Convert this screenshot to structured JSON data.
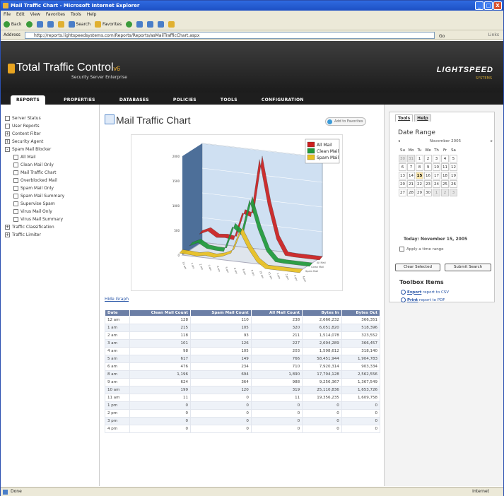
{
  "window": {
    "title": "Mail Traffic Chart - Microsoft Internet Explorer",
    "min": "_",
    "max": "□",
    "close": "X"
  },
  "menu": [
    "File",
    "Edit",
    "View",
    "Favorites",
    "Tools",
    "Help"
  ],
  "toolbar": {
    "back": "Back",
    "search": "Search",
    "favorites": "Favorites"
  },
  "address": {
    "label": "Address",
    "url": "http://reports.lightspeedsystems.com/Reports/Reports/asMailTrafficChart.aspx",
    "go": "Go",
    "links": "Links"
  },
  "brand": {
    "name": "Total Traffic Control",
    "version": "v6",
    "sub": "Security Server Enterprise",
    "vendor": "LIGHTSPEED",
    "vendor_sub": "SYSTEMS"
  },
  "nav": [
    "REPORTS",
    "PROPERTIES",
    "DATABASES",
    "POLICIES",
    "TOOLS",
    "CONFIGURATION"
  ],
  "sidebar": [
    {
      "label": "Server Status",
      "box": "",
      "child": false
    },
    {
      "label": "User Reports",
      "box": "",
      "child": false
    },
    {
      "label": "Content Filter",
      "box": "+",
      "child": false
    },
    {
      "label": "Security Agent",
      "box": "+",
      "child": false
    },
    {
      "label": "Spam Mail Blocker",
      "box": "-",
      "child": false
    },
    {
      "label": "All Mail",
      "box": "",
      "child": true
    },
    {
      "label": "Clean Mail Only",
      "box": "",
      "child": true
    },
    {
      "label": "Mail Traffic Chart",
      "box": "",
      "child": true
    },
    {
      "label": "Overblocked Mail",
      "box": "",
      "child": true
    },
    {
      "label": "Spam Mail Only",
      "box": "",
      "child": true
    },
    {
      "label": "Spam Mail Summary",
      "box": "",
      "child": true
    },
    {
      "label": "Supervise Spam",
      "box": "",
      "child": true
    },
    {
      "label": "Virus Mail Only",
      "box": "",
      "child": true
    },
    {
      "label": "Virus Mail Summary",
      "box": "",
      "child": true
    },
    {
      "label": "Traffic Classification",
      "box": "+",
      "child": false
    },
    {
      "label": "Traffic Limiter",
      "box": "+",
      "child": false
    }
  ],
  "main": {
    "title": "Mail Traffic Chart",
    "add_fav": "Add to Favorites",
    "hide_graph": "Hide Graph"
  },
  "legend": [
    {
      "name": "All Mail",
      "color": "#cc1f1f"
    },
    {
      "name": "Clean Mail",
      "color": "#1f9a3a"
    },
    {
      "name": "Spam Mail",
      "color": "#e8c020"
    }
  ],
  "chart_data": {
    "type": "line",
    "series": [
      {
        "name": "All Mail",
        "values": [
          238,
          320,
          211,
          227,
          203,
          766,
          710,
          1890,
          988,
          319,
          11,
          0,
          0,
          0,
          0
        ]
      },
      {
        "name": "Clean Mail",
        "values": [
          128,
          215,
          118,
          101,
          98,
          617,
          476,
          1196,
          624,
          199,
          11,
          0,
          0,
          0,
          0
        ]
      },
      {
        "name": "Spam Mail",
        "values": [
          110,
          105,
          93,
          126,
          105,
          149,
          234,
          694,
          364,
          120,
          0,
          0,
          0,
          0,
          0
        ]
      }
    ],
    "y_ticks": [
      "2000",
      "1500",
      "1000",
      "500",
      "0"
    ],
    "ylim": [
      0,
      2000
    ]
  },
  "table": {
    "headers": [
      "Date",
      "Clean Mail Count",
      "Spam Mail Count",
      "All Mail Count",
      "Bytes In",
      "Bytes Out"
    ],
    "rows": [
      [
        "12 am",
        "128",
        "110",
        "238",
        "2,666,232",
        "366,351"
      ],
      [
        "1 am",
        "215",
        "105",
        "320",
        "6,051,820",
        "518,396"
      ],
      [
        "2 am",
        "118",
        "93",
        "211",
        "1,514,078",
        "323,552"
      ],
      [
        "3 am",
        "101",
        "126",
        "227",
        "2,694,289",
        "366,457"
      ],
      [
        "4 am",
        "98",
        "105",
        "203",
        "1,598,612",
        "318,140"
      ],
      [
        "5 am",
        "617",
        "149",
        "766",
        "58,451,944",
        "1,904,783"
      ],
      [
        "6 am",
        "476",
        "234",
        "710",
        "7,920,314",
        "903,334"
      ],
      [
        "8 am",
        "1,196",
        "694",
        "1,890",
        "17,794,128",
        "2,562,556"
      ],
      [
        "9 am",
        "624",
        "364",
        "988",
        "9,256,367",
        "1,367,549"
      ],
      [
        "10 am",
        "199",
        "120",
        "319",
        "25,110,836",
        "1,653,726"
      ],
      [
        "11 am",
        "11",
        "0",
        "11",
        "19,356,235",
        "1,609,758"
      ],
      [
        "1 pm",
        "0",
        "0",
        "0",
        "0",
        "0"
      ],
      [
        "2 pm",
        "0",
        "0",
        "0",
        "0",
        "0"
      ],
      [
        "3 pm",
        "0",
        "0",
        "0",
        "0",
        "0"
      ],
      [
        "4 pm",
        "0",
        "0",
        "0",
        "0",
        "0"
      ]
    ]
  },
  "panel": {
    "tabs": [
      "Tools",
      "Help"
    ],
    "date_range": "Date Range",
    "month": "November 2005",
    "prev": "◂",
    "next": "▸",
    "weekdays": [
      "Su",
      "Mo",
      "Tu",
      "We",
      "Th",
      "Fr",
      "Sa"
    ],
    "weeks": [
      [
        "30",
        "31",
        "1",
        "2",
        "3",
        "4",
        "5"
      ],
      [
        "6",
        "7",
        "8",
        "9",
        "10",
        "11",
        "12"
      ],
      [
        "13",
        "14",
        "15",
        "16",
        "17",
        "18",
        "19"
      ],
      [
        "20",
        "21",
        "22",
        "23",
        "24",
        "25",
        "26"
      ],
      [
        "27",
        "28",
        "29",
        "30",
        "1",
        "2",
        "3"
      ]
    ],
    "today": "Today: November 15, 2005",
    "apply_time": "Apply a time range",
    "clear_btn": "Clear Selected",
    "submit_btn": "Submit Search",
    "toolbox_title": "Toolbox Items",
    "export_csv_b": "Export",
    "export_csv": " report to CSV",
    "print_pdf_b": "Print",
    "print_pdf": " report to PDF"
  },
  "status": {
    "left": "Done",
    "zone": "Internet"
  }
}
